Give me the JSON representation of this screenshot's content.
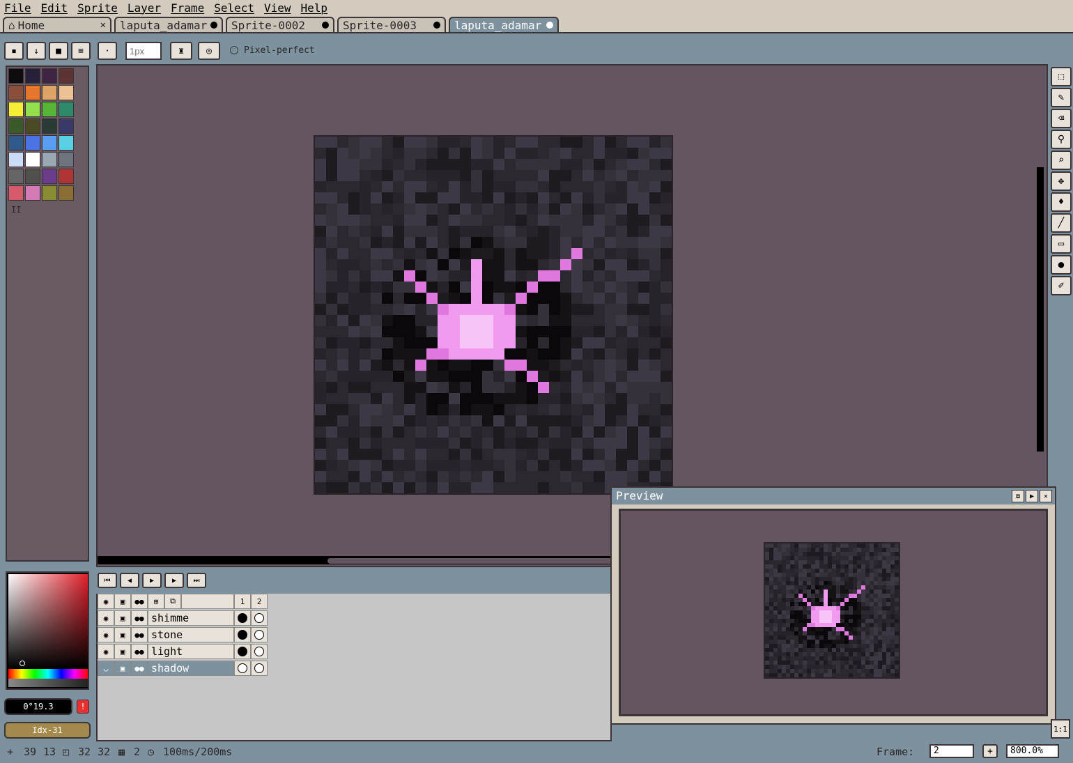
{
  "menu": [
    "File",
    "Edit",
    "Sprite",
    "Layer",
    "Frame",
    "Select",
    "View",
    "Help"
  ],
  "tabs": [
    {
      "label": "Home",
      "icon": "home-icon",
      "closable": true
    },
    {
      "label": "laputa_adamar",
      "modified": true
    },
    {
      "label": "Sprite-0002",
      "modified": true
    },
    {
      "label": "Sprite-0003",
      "modified": true
    },
    {
      "label": "laputa_adamar",
      "modified": true,
      "active": true
    }
  ],
  "context": {
    "brush_size": "1px",
    "pixel_perfect_label": "Pixel-perfect"
  },
  "palette": {
    "colors": [
      "#0d0b0e",
      "#26203a",
      "#3f2444",
      "#5d3434",
      "#8a4f3a",
      "#e5762a",
      "#dea466",
      "#ecc193",
      "#f4ee34",
      "#92e04c",
      "#58b436",
      "#2d8a6a",
      "#3a5a2a",
      "#4a4a24",
      "#2a3a34",
      "#3a3a6a",
      "#2e5a8a",
      "#4a74e4",
      "#5a9ef2",
      "#5ad0e4",
      "#cadcf8",
      "#ffffff",
      "#9aa8b4",
      "#6e747e",
      "#646464",
      "#50504c",
      "#6a3c8a",
      "#b03434",
      "#d65a6a",
      "#d67ab6",
      "#8a8c34",
      "#8a6e34"
    ],
    "columns_label": "II"
  },
  "colors": {
    "foreground": "0°19.3",
    "index": "Idx-31",
    "accent_pink": "#f09af0",
    "canvas_bg": "#655560"
  },
  "timeline": {
    "frames": [
      "1",
      "2"
    ],
    "layers": [
      {
        "name": "shimme",
        "cels": [
          "full",
          "empty"
        ]
      },
      {
        "name": "stone",
        "cels": [
          "full",
          "empty"
        ]
      },
      {
        "name": "light",
        "cels": [
          "full",
          "empty"
        ]
      },
      {
        "name": "shadow",
        "cels": [
          "empty",
          "empty"
        ],
        "selected": true
      }
    ]
  },
  "preview": {
    "title": "Preview"
  },
  "status": {
    "cursor_x": "39",
    "cursor_y": "13",
    "size_w": "32",
    "size_h": "32",
    "frames": "2",
    "duration": "100ms/200ms",
    "frame_label": "Frame:",
    "frame_value": "2",
    "zoom": "800.0%",
    "one_to_one": "1:1"
  }
}
